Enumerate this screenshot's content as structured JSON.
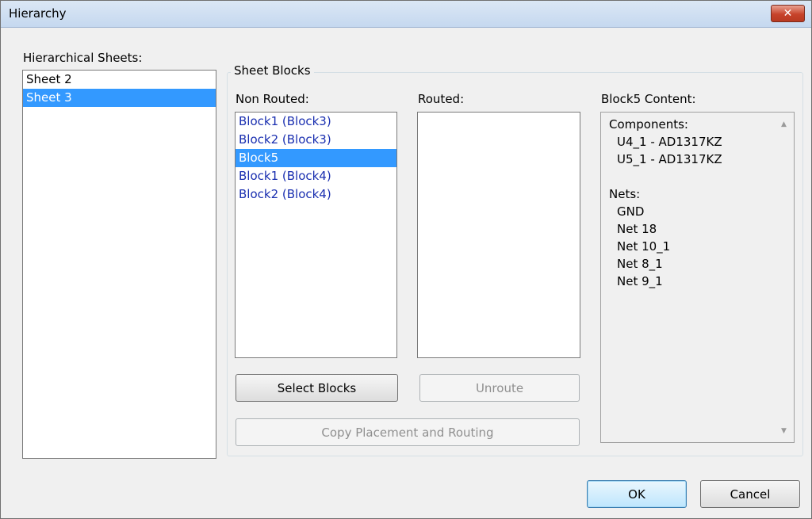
{
  "window": {
    "title": "Hierarchy",
    "close_glyph": "✕"
  },
  "sheets": {
    "label": "Hierarchical Sheets:",
    "items": [
      "Sheet 2",
      "Sheet 3"
    ],
    "selected": "Sheet 3"
  },
  "sheet_blocks": {
    "title": "Sheet Blocks",
    "non_routed": {
      "label": "Non Routed:",
      "items": [
        "Block1 (Block3)",
        "Block2 (Block3)",
        "Block5",
        "Block1 (Block4)",
        "Block2 (Block4)"
      ],
      "selected": "Block5"
    },
    "routed": {
      "label": "Routed:",
      "items": []
    },
    "content": {
      "label": "Block5 Content:",
      "components_heading": "Components:",
      "components": [
        "U4_1 - AD1317KZ",
        "U5_1 - AD1317KZ"
      ],
      "nets_heading": "Nets:",
      "nets": [
        "GND",
        "Net 18",
        "Net 10_1",
        "Net 8_1",
        "Net 9_1"
      ],
      "scroll_up_icon": "▲",
      "scroll_down_icon": "▼"
    },
    "buttons": {
      "select_blocks": "Select Blocks",
      "unroute": "Unroute",
      "copy_placement": "Copy Placement and Routing"
    }
  },
  "footer": {
    "ok": "OK",
    "cancel": "Cancel"
  },
  "colors": {
    "selection": "#3399ff",
    "block_text": "#1a2fb0"
  }
}
